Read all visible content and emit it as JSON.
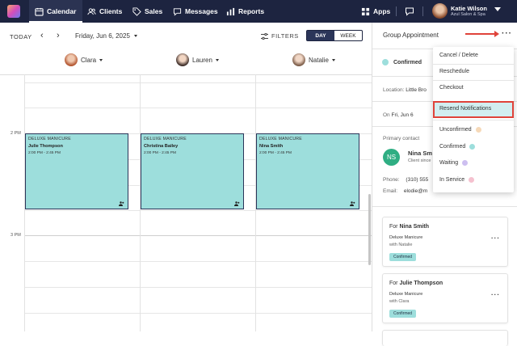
{
  "nav": {
    "items": [
      {
        "label": "Calendar",
        "icon": "calendar-icon"
      },
      {
        "label": "Clients",
        "icon": "users-icon"
      },
      {
        "label": "Sales",
        "icon": "tag-icon"
      },
      {
        "label": "Messages",
        "icon": "chat-icon"
      },
      {
        "label": "Reports",
        "icon": "bar-chart-icon"
      }
    ],
    "apps_label": "Apps",
    "user_name": "Katie Wilson",
    "user_business": "Azul Salon & Spa"
  },
  "toolbar": {
    "today": "TODAY",
    "prev": "‹",
    "next": "›",
    "date": "Friday, Jun 6, 2025",
    "filters": "FILTERS",
    "day": "DAY",
    "week": "WEEK"
  },
  "staff": [
    "Clara",
    "Lauren",
    "Natalie"
  ],
  "times": [
    "2 PM",
    "3 PM"
  ],
  "appointments": [
    {
      "service": "DELUXE MANICURE",
      "client": "Julie Thompson",
      "time": "2:00 PM - 2:45 PM"
    },
    {
      "service": "DELUXE MANICURE",
      "client": "Christina Bailey",
      "time": "2:00 PM - 2:45 PM"
    },
    {
      "service": "DELUXE MANICURE",
      "client": "Nina Smith",
      "time": "2:00 PM - 2:45 PM"
    }
  ],
  "panel": {
    "title": "Group Appointment",
    "status": "Confirmed",
    "location_label": "Location:",
    "location_value": "Little Bro",
    "on_label": "On",
    "on_value": "Fri, Jun 6",
    "primary_contact_label": "Primary contact",
    "contact_initials": "NS",
    "contact_name": "Nina Sm",
    "contact_sub": "Client since",
    "phone_label": "Phone:",
    "phone_value": "(310) 555",
    "email_label": "Email:",
    "email_value": "elodie@m",
    "cards": [
      {
        "for": "For",
        "name": "Nina Smith",
        "service": "Deluxe Manicure",
        "with": "with",
        "staff": "Natalie",
        "status": "Confirmed"
      },
      {
        "for": "For",
        "name": "Julie Thompson",
        "service": "Deluxe Manicure",
        "with": "with",
        "staff": "Clara",
        "status": "Confirmed"
      }
    ]
  },
  "menu": {
    "items": [
      {
        "label": "Cancel / Delete"
      },
      {
        "label": "Reschedule"
      },
      {
        "label": "Checkout"
      },
      {
        "label": "Resend Notifications",
        "highlighted": true
      },
      {
        "label": "Unconfirmed",
        "color": "#f6d9b8"
      },
      {
        "label": "Confirmed",
        "color": "#9ddedc"
      },
      {
        "label": "Waiting",
        "color": "#cdbff0"
      },
      {
        "label": "In Service",
        "color": "#f5c1cf"
      }
    ]
  },
  "colors": {
    "nav_bg": "#1d2440",
    "appointment": "#9ddedc",
    "highlight_border": "#e0433a"
  }
}
